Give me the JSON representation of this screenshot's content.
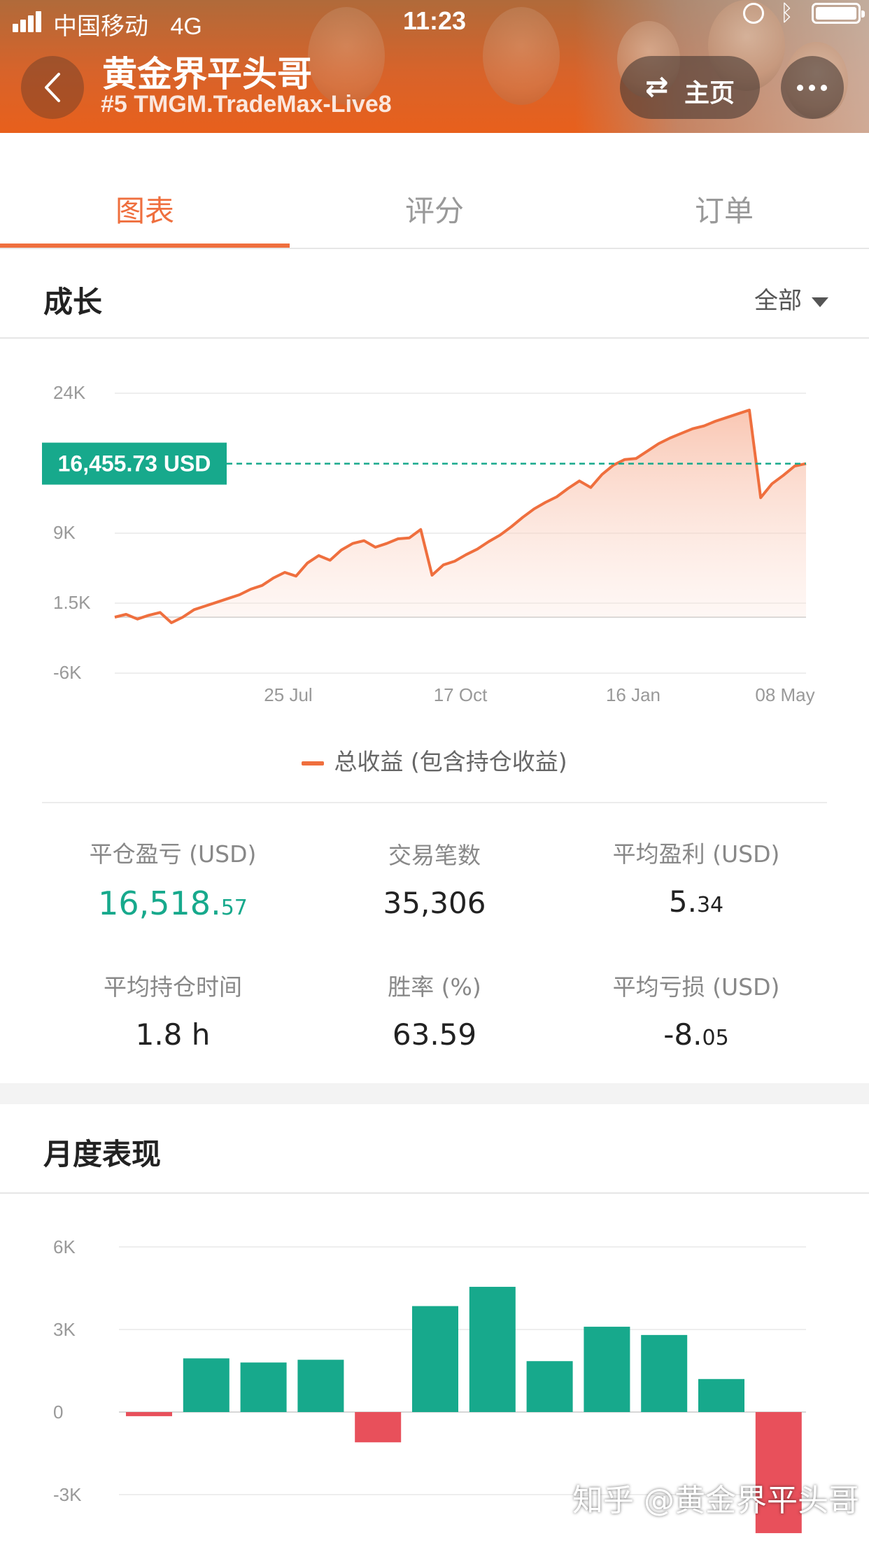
{
  "status_bar": {
    "carrier": "中国移动",
    "network": "4G",
    "time": "11:23"
  },
  "header": {
    "title": "黄金界平头哥",
    "subtitle": "#5 TMGM.TradeMax-Live8",
    "home_label": "主页"
  },
  "tabs": [
    {
      "label": "图表",
      "active": true
    },
    {
      "label": "评分",
      "active": false
    },
    {
      "label": "订单",
      "active": false
    }
  ],
  "growth": {
    "title": "成长",
    "filter_label": "全部",
    "current_value_label": "16,455.73 USD",
    "legend_label": "总收益 (包含持仓收益)"
  },
  "stats": [
    {
      "label": "平仓盈亏 (USD)",
      "value_main": "16,518.",
      "value_small": "57",
      "green": true
    },
    {
      "label": "交易笔数",
      "value_main": "35,306",
      "value_small": ""
    },
    {
      "label": "平均盈利 (USD)",
      "value_main": "5.",
      "value_small": "34"
    },
    {
      "label": "平均持仓时间",
      "value_main": "1.8 h",
      "value_small": ""
    },
    {
      "label": "胜率 (%)",
      "value_main": "63.59",
      "value_small": ""
    },
    {
      "label": "平均亏损 (USD)",
      "value_main": "-8.",
      "value_small": "05"
    }
  ],
  "monthly": {
    "title": "月度表现"
  },
  "watermark": "知乎 @黄金界平头哥",
  "colors": {
    "accent": "#ef6f3e",
    "green": "#17a98c",
    "red": "#e8505b"
  },
  "chart_data": [
    {
      "type": "area",
      "series": [
        {
          "name": "总收益 (包含持仓收益)",
          "color": "#ef6f3e"
        }
      ],
      "y_ticks": [
        "24K",
        "9K",
        "1.5K",
        "-6K"
      ],
      "ylim": [
        -6000,
        24000
      ],
      "x_ticks": [
        "25 Jul",
        "17 Oct",
        "16 Jan",
        "08 May"
      ],
      "current_value": 16455.73,
      "values": [
        0,
        300,
        -200,
        200,
        500,
        -600,
        0,
        800,
        1200,
        1600,
        2000,
        2400,
        3000,
        3400,
        4200,
        4800,
        4400,
        5800,
        6600,
        6100,
        7200,
        7900,
        8200,
        7500,
        7900,
        8400,
        8500,
        9400,
        4500,
        5600,
        6000,
        6700,
        7300,
        8100,
        8800,
        9700,
        10700,
        11600,
        12300,
        12900,
        13800,
        14600,
        13900,
        15300,
        16300,
        16900,
        17000,
        17800,
        18600,
        19200,
        19700,
        20200,
        20500,
        21000,
        21400,
        21800,
        22200,
        12800,
        14300,
        15200,
        16200,
        16455.73
      ]
    },
    {
      "type": "bar",
      "y_ticks": [
        "6K",
        "3K",
        "0",
        "-3K"
      ],
      "ylim": [
        -3000,
        6000
      ],
      "values": [
        -150,
        1950,
        1800,
        1900,
        -1100,
        3850,
        4550,
        1850,
        3100,
        2800,
        1200,
        -4400
      ]
    }
  ]
}
